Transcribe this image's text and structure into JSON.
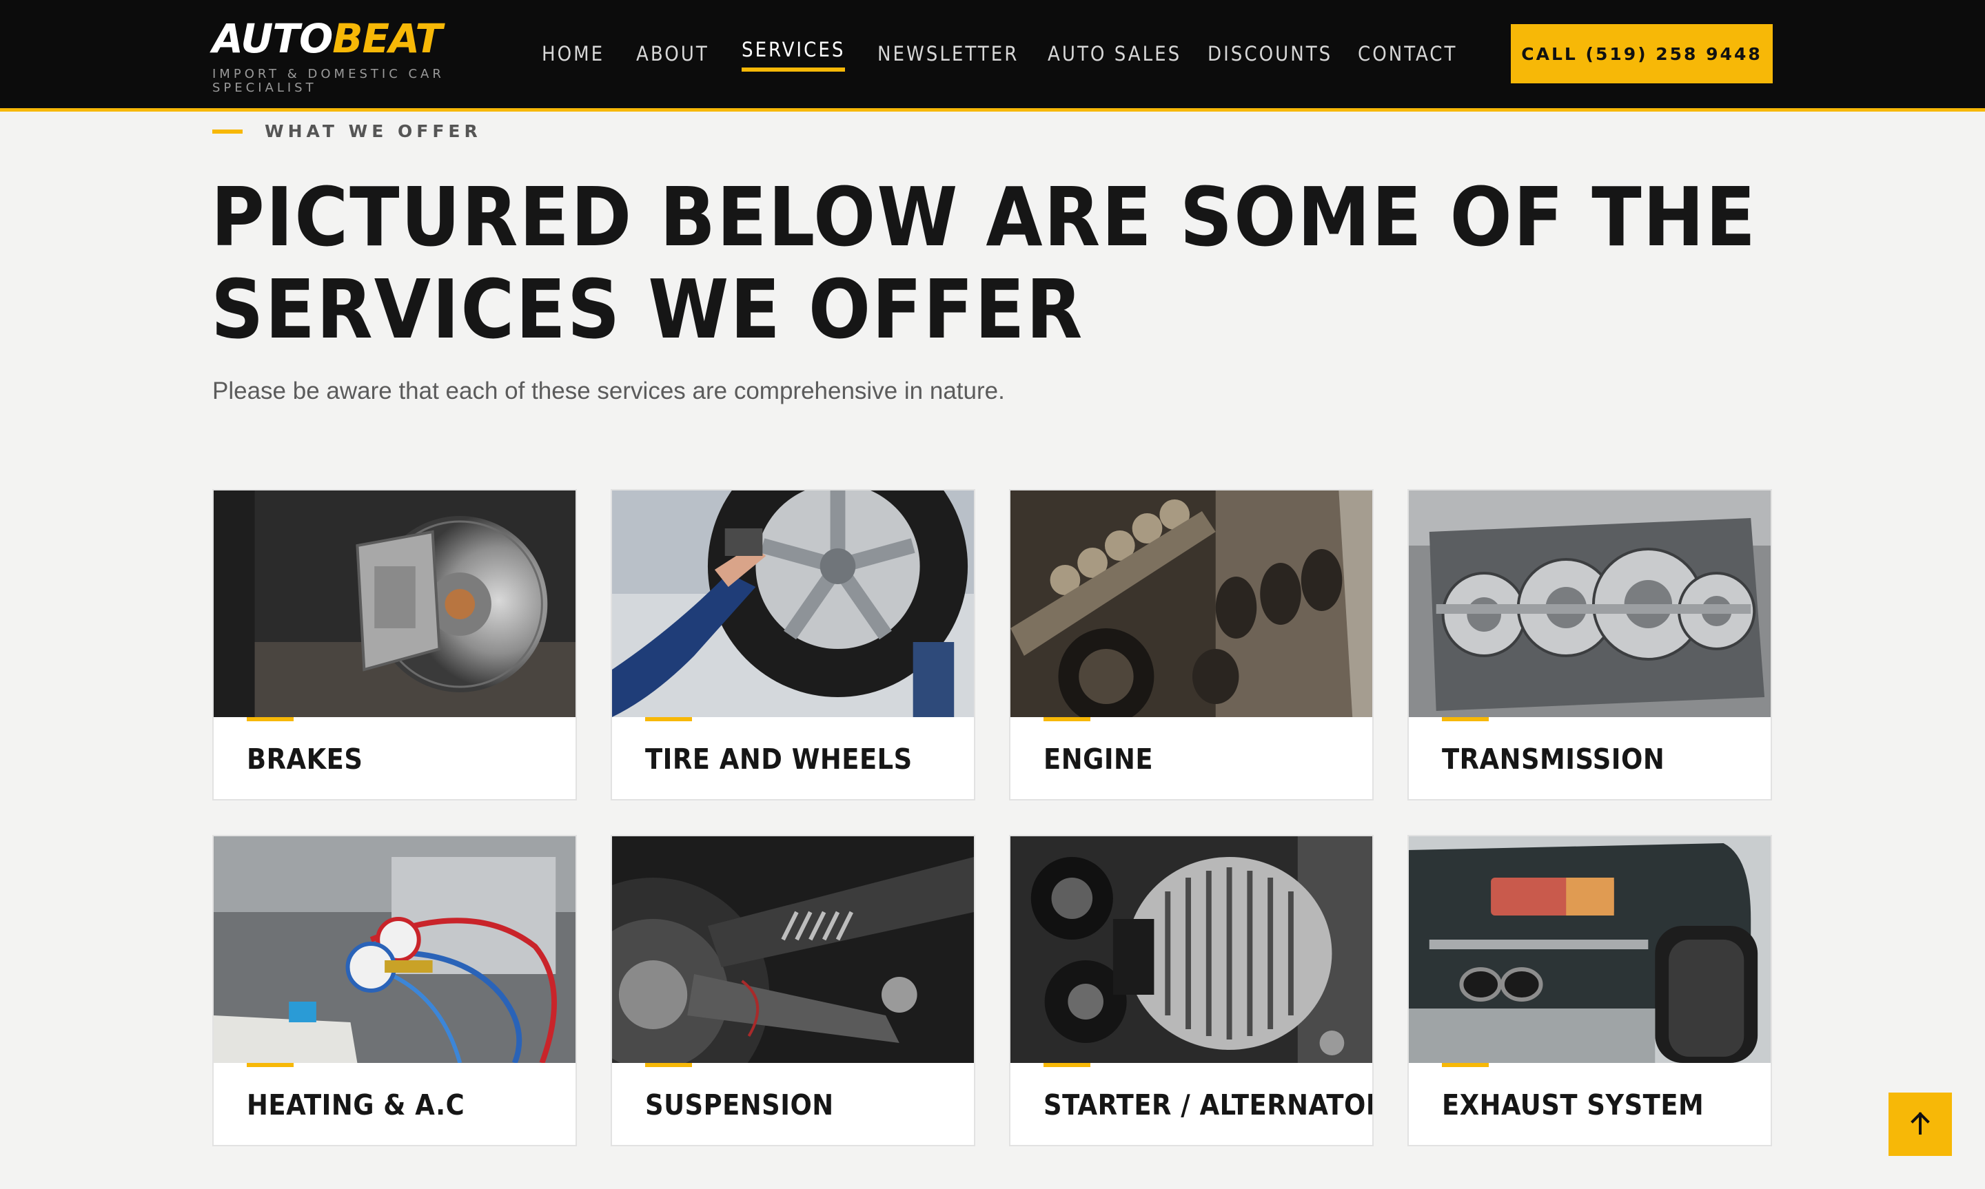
{
  "header": {
    "logo_part1": "AUTO",
    "logo_part2": "BEAT",
    "tagline": "IMPORT & DOMESTIC CAR SPECIALIST",
    "nav": [
      {
        "label": "HOME",
        "active": false
      },
      {
        "label": "ABOUT",
        "active": false
      },
      {
        "label": "SERVICES",
        "active": true
      },
      {
        "label": "NEWSLETTER",
        "active": false
      },
      {
        "label": "AUTO SALES",
        "active": false
      },
      {
        "label": "DISCOUNTS",
        "active": false
      },
      {
        "label": "CONTACT",
        "active": false
      }
    ],
    "call_label": "CALL (519) 258 9448"
  },
  "intro": {
    "eyebrow": "WHAT WE OFFER",
    "headline": "PICTURED BELOW ARE SOME OF THE SERVICES WE OFFER",
    "subtext": "Please be aware that each of these services are comprehensive in nature."
  },
  "services": [
    {
      "title": "BRAKES",
      "image": "brake-disc-photo"
    },
    {
      "title": "TIRE AND WHEELS",
      "image": "tire-wheel-photo"
    },
    {
      "title": "ENGINE",
      "image": "engine-photo"
    },
    {
      "title": "TRANSMISSION",
      "image": "transmission-photo"
    },
    {
      "title": "HEATING & A.C",
      "image": "ac-gauges-photo"
    },
    {
      "title": "SUSPENSION",
      "image": "suspension-photo"
    },
    {
      "title": "STARTER / ALTERNATOR",
      "image": "alternator-photo"
    },
    {
      "title": "EXHAUST SYSTEM",
      "image": "exhaust-photo"
    }
  ],
  "icons": {
    "back_to_top": "arrow-up-icon"
  },
  "colors": {
    "accent": "#f7b807",
    "header_bg": "#0c0c0c",
    "page_bg": "#f3f3f2"
  }
}
